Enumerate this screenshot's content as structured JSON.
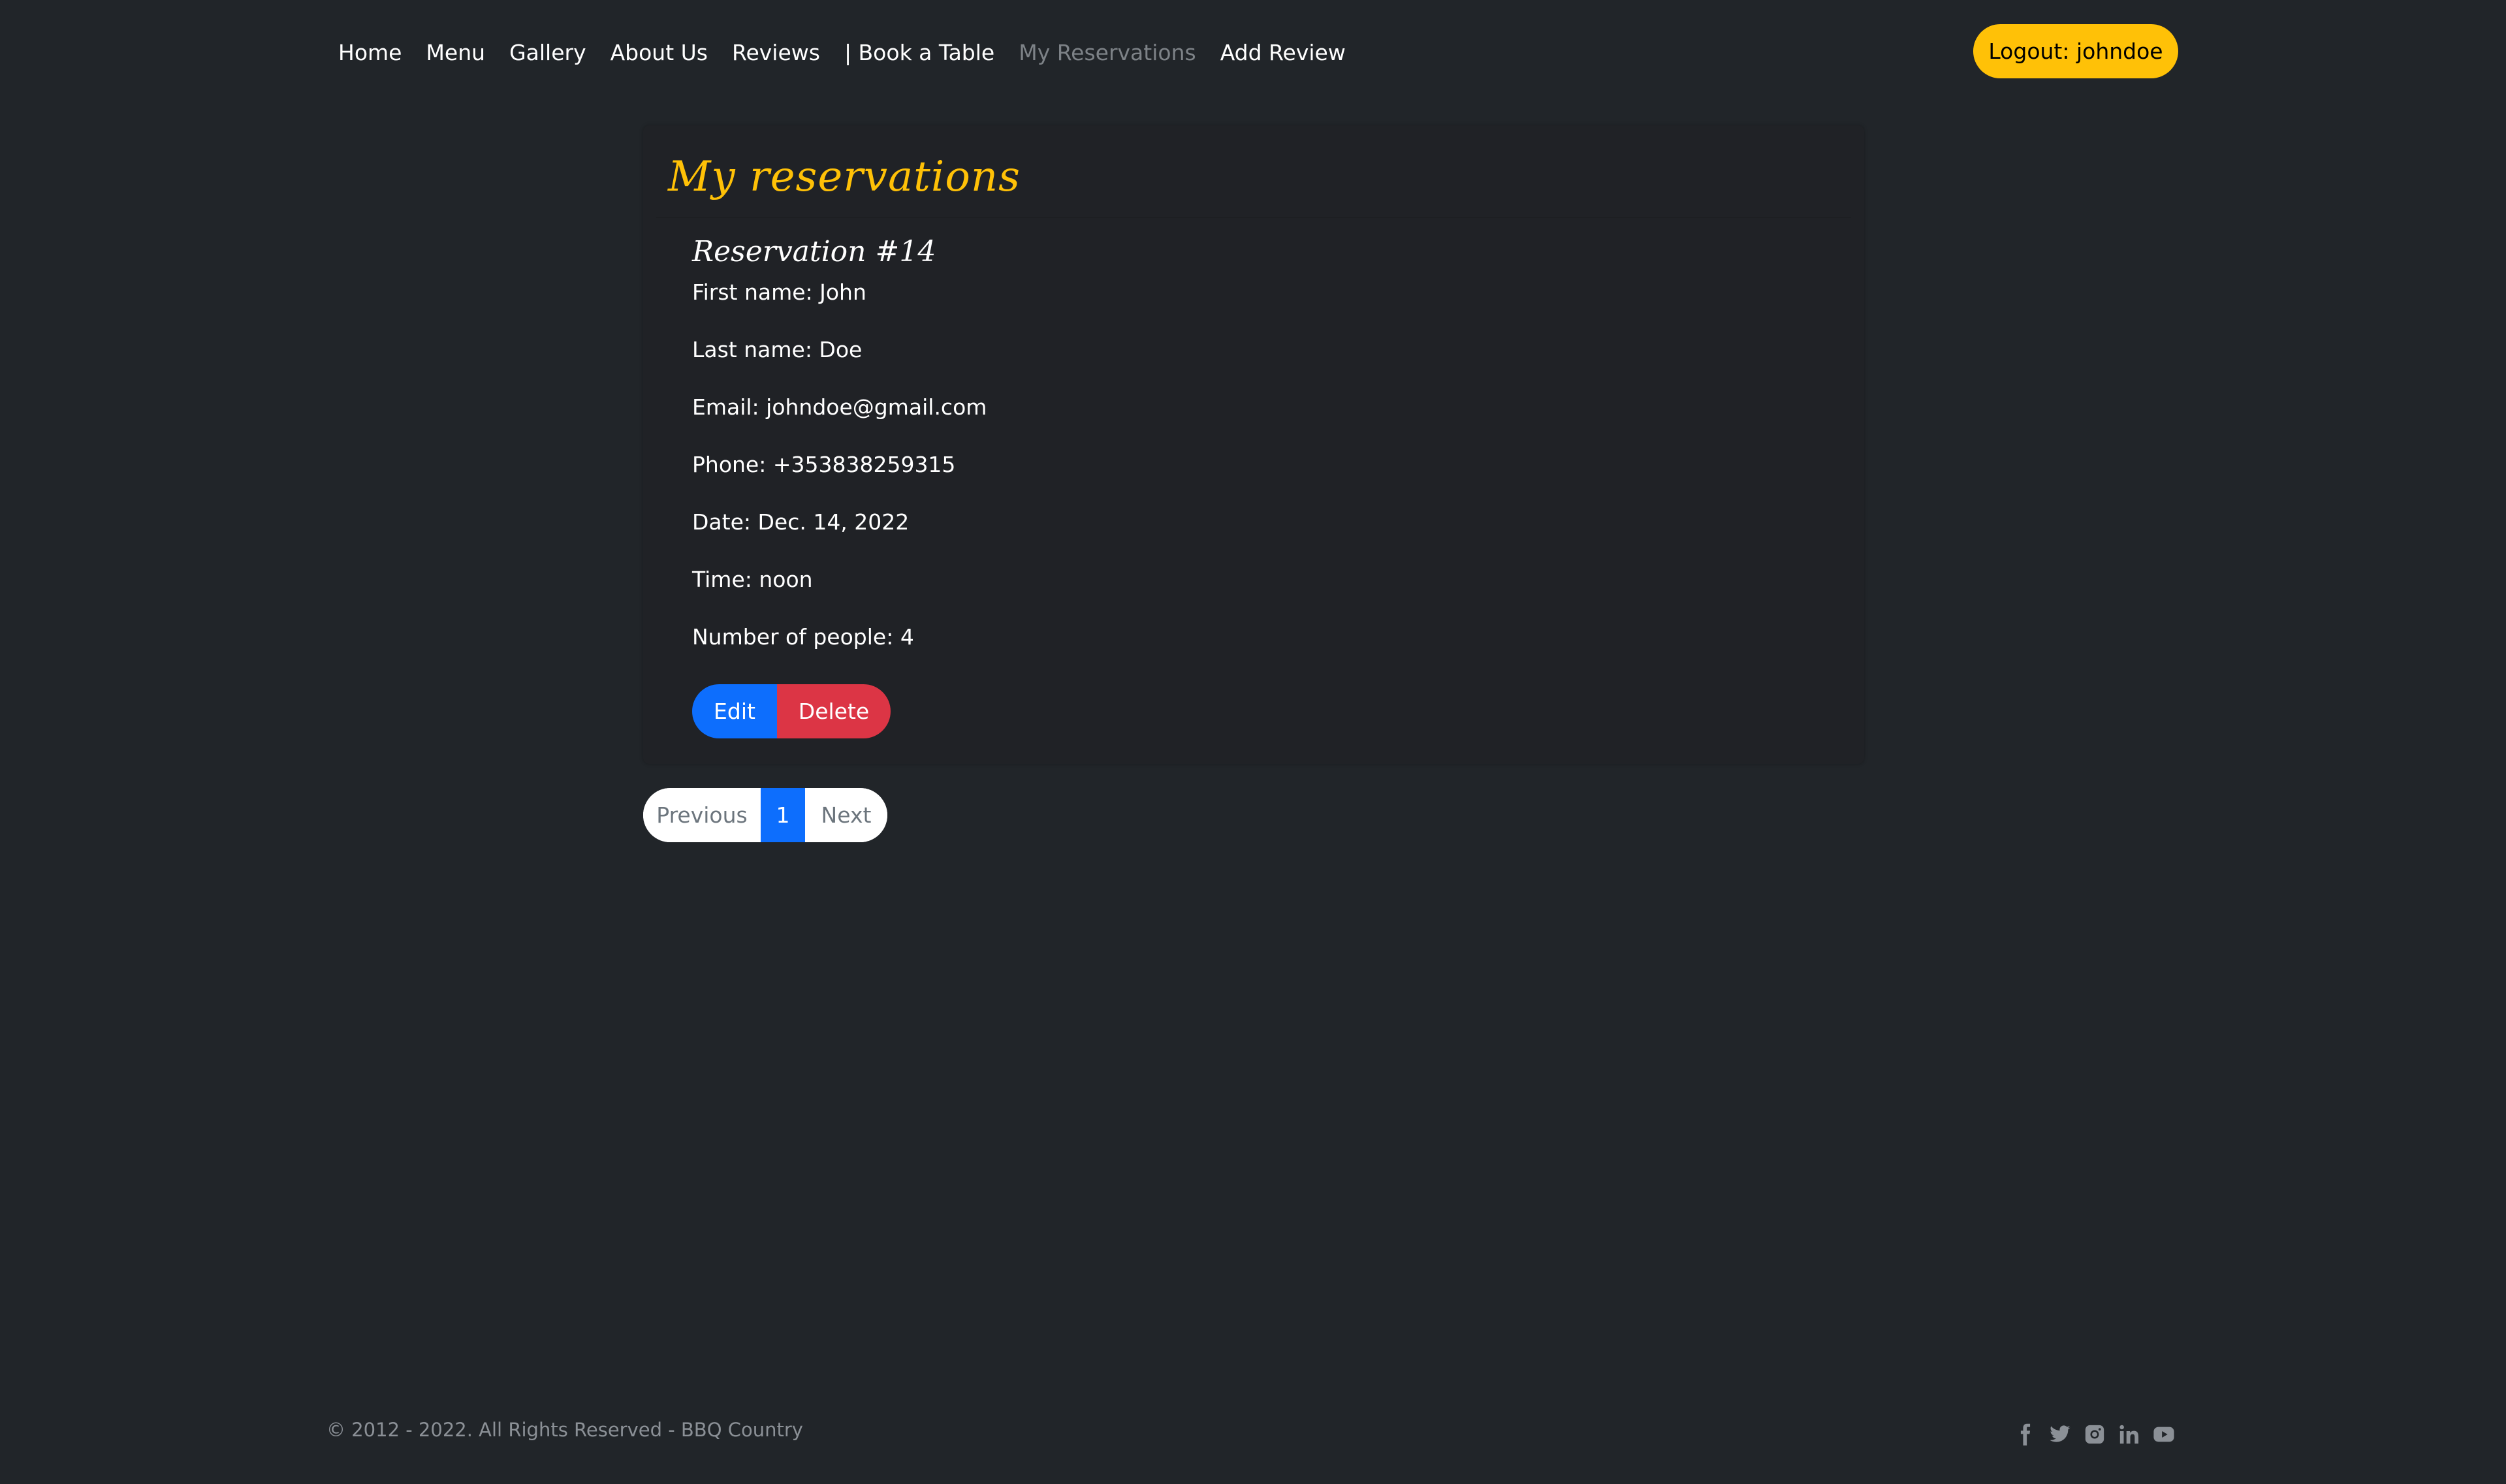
{
  "nav": {
    "items": [
      {
        "label": "Home"
      },
      {
        "label": "Menu"
      },
      {
        "label": "Gallery"
      },
      {
        "label": "About Us"
      },
      {
        "label": "Reviews"
      },
      {
        "label": "| Book a Table"
      },
      {
        "label": "My Reservations",
        "active": true
      },
      {
        "label": "Add Review"
      }
    ],
    "logout_label": "Logout: johndoe"
  },
  "page": {
    "title": "My reservations"
  },
  "reservation": {
    "title": "Reservation #14",
    "fields": [
      "First name: John",
      "Last name: Doe",
      "Email: johndoe@gmail.com",
      "Phone: +353838259315",
      "Date: Dec. 14, 2022",
      "Time: noon",
      "Number of people: 4"
    ],
    "edit_label": "Edit",
    "delete_label": "Delete"
  },
  "pagination": {
    "previous_label": "Previous",
    "current_page": "1",
    "next_label": "Next"
  },
  "footer": {
    "copyright": "© 2012 - 2022. All Rights Reserved - BBQ Country",
    "social_icons": [
      "facebook-icon",
      "twitter-icon",
      "instagram-icon",
      "linkedin-icon",
      "youtube-icon"
    ]
  },
  "colors": {
    "background": "#212529",
    "accent": "#ffc107",
    "primary": "#0d6efd",
    "danger": "#dc3545",
    "muted": "#7d8287"
  }
}
